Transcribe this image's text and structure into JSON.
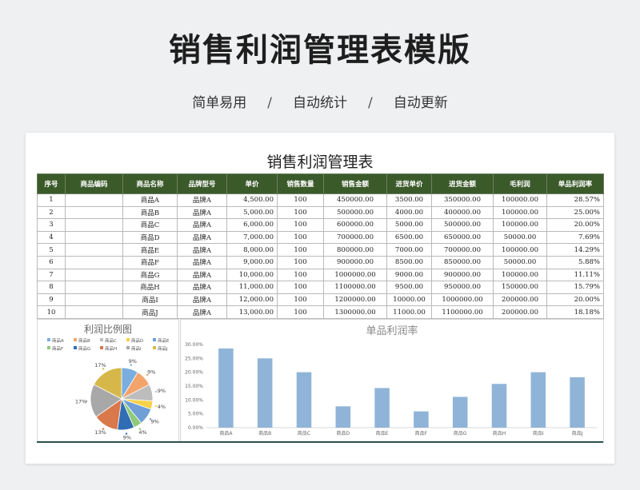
{
  "hero": {
    "title": "销售利润管理表模版",
    "tags": [
      "简单易用",
      "自动统计",
      "自动更新"
    ],
    "separator": "/"
  },
  "sheet": {
    "title": "销售利润管理表",
    "headers": [
      "序号",
      "商品编码",
      "商品名称",
      "品牌型号",
      "单价",
      "销售数量",
      "销售金额",
      "进货单价",
      "进货金额",
      "毛利润",
      "单品利润率"
    ],
    "rows": [
      {
        "no": "1",
        "code": "",
        "name": "商品A",
        "brand": "品牌A",
        "price": "4,500.00",
        "qty": "100",
        "sales": "450000.00",
        "cost_price": "3500.00",
        "cost": "350000.00",
        "profit": "100000.00",
        "margin": "28.57%"
      },
      {
        "no": "2",
        "code": "",
        "name": "商品B",
        "brand": "品牌A",
        "price": "5,000.00",
        "qty": "100",
        "sales": "500000.00",
        "cost_price": "4000.00",
        "cost": "400000.00",
        "profit": "100000.00",
        "margin": "25.00%"
      },
      {
        "no": "3",
        "code": "",
        "name": "商品C",
        "brand": "品牌A",
        "price": "6,000.00",
        "qty": "100",
        "sales": "600000.00",
        "cost_price": "5000.00",
        "cost": "500000.00",
        "profit": "100000.00",
        "margin": "20.00%"
      },
      {
        "no": "4",
        "code": "",
        "name": "商品D",
        "brand": "品牌A",
        "price": "7,000.00",
        "qty": "100",
        "sales": "700000.00",
        "cost_price": "6500.00",
        "cost": "650000.00",
        "profit": "50000.00",
        "margin": "7.69%"
      },
      {
        "no": "5",
        "code": "",
        "name": "商品E",
        "brand": "品牌A",
        "price": "8,000.00",
        "qty": "100",
        "sales": "800000.00",
        "cost_price": "7000.00",
        "cost": "700000.00",
        "profit": "100000.00",
        "margin": "14.29%"
      },
      {
        "no": "6",
        "code": "",
        "name": "商品F",
        "brand": "品牌A",
        "price": "9,000.00",
        "qty": "100",
        "sales": "900000.00",
        "cost_price": "8500.00",
        "cost": "850000.00",
        "profit": "50000.00",
        "margin": "5.88%"
      },
      {
        "no": "7",
        "code": "",
        "name": "商品G",
        "brand": "品牌A",
        "price": "10,000.00",
        "qty": "100",
        "sales": "1000000.00",
        "cost_price": "9000.00",
        "cost": "900000.00",
        "profit": "100000.00",
        "margin": "11.11%"
      },
      {
        "no": "8",
        "code": "",
        "name": "商品H",
        "brand": "品牌A",
        "price": "11,000.00",
        "qty": "100",
        "sales": "1100000.00",
        "cost_price": "9500.00",
        "cost": "950000.00",
        "profit": "150000.00",
        "margin": "15.79%"
      },
      {
        "no": "9",
        "code": "",
        "name": "商品I",
        "brand": "品牌A",
        "price": "12,000.00",
        "qty": "100",
        "sales": "1200000.00",
        "cost_price": "10000.00",
        "cost": "1000000.00",
        "profit": "200000.00",
        "margin": "20.00%"
      },
      {
        "no": "10",
        "code": "",
        "name": "商品J",
        "brand": "品牌A",
        "price": "13,000.00",
        "qty": "100",
        "sales": "1300000.00",
        "cost_price": "11000.00",
        "cost": "1100000.00",
        "profit": "200000.00",
        "margin": "18.18%"
      }
    ]
  },
  "chart_data": [
    {
      "type": "pie",
      "title": "利润比例图",
      "legend_position": "top",
      "categories": [
        "商品A",
        "商品B",
        "商品C",
        "商品D",
        "商品E",
        "商品F",
        "商品G",
        "商品H",
        "商品I",
        "商品J"
      ],
      "values": [
        100000,
        100000,
        100000,
        50000,
        100000,
        50000,
        100000,
        150000,
        200000,
        200000
      ],
      "slice_labels": [
        "9%",
        "9%",
        "9%",
        "4%",
        "9%",
        "4%",
        "9%",
        "13%",
        "17%",
        "17%"
      ],
      "colors": [
        "#7aaee0",
        "#f3a46b",
        "#bdbdbd",
        "#f5d24a",
        "#6f9fd6",
        "#8fc97a",
        "#2f6db5",
        "#d9784a",
        "#a8a8a8",
        "#d6b84a"
      ]
    },
    {
      "type": "bar",
      "title": "单品利润率",
      "categories": [
        "商品A",
        "商品B",
        "商品C",
        "商品D",
        "商品E",
        "商品F",
        "商品G",
        "商品H",
        "商品I",
        "商品J"
      ],
      "values": [
        28.57,
        25.0,
        20.0,
        7.69,
        14.29,
        5.88,
        11.11,
        15.79,
        20.0,
        18.18
      ],
      "ylim": [
        0,
        30
      ],
      "yticks": [
        "0.00%",
        "5.00%",
        "10.00%",
        "15.00%",
        "20.00%",
        "25.00%",
        "30.00%"
      ],
      "grid": false,
      "bar_color": "#8fb4d8"
    }
  ]
}
